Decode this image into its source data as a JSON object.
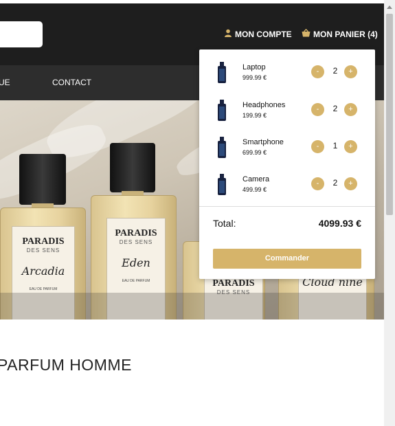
{
  "header": {
    "account_label": "MON COMPTE",
    "cart_label": "MON PANIER (4)",
    "account_icon": "user-icon",
    "cart_icon": "basket-icon"
  },
  "nav": {
    "items": [
      {
        "label": "UE"
      },
      {
        "label": "CONTACT"
      }
    ]
  },
  "hero": {
    "bottles": [
      {
        "brand": "PARADIS",
        "sub": "DES SENS",
        "script": "Arcadia",
        "small": "EAU DE PARFUM"
      },
      {
        "brand": "PARADIS",
        "sub": "DES SENS",
        "script": "Eden",
        "small": "EAU DE PARFUM"
      },
      {
        "brand": "PARADIS",
        "sub": "DES SENS",
        "script": "",
        "small": ""
      },
      {
        "brand": "",
        "sub": "",
        "script": "Cloud nine",
        "small": ""
      }
    ]
  },
  "section": {
    "title": "PARFUM HOMME"
  },
  "cart": {
    "items": [
      {
        "name": "Laptop",
        "price": "999.99 €",
        "qty": "2"
      },
      {
        "name": "Headphones",
        "price": "199.99 €",
        "qty": "2"
      },
      {
        "name": "Smartphone",
        "price": "699.99 €",
        "qty": "1"
      },
      {
        "name": "Camera",
        "price": "499.99 €",
        "qty": "2"
      }
    ],
    "minus_label": "-",
    "plus_label": "+",
    "total_label": "Total:",
    "total_value": "4099.93 €",
    "checkout_label": "Commander"
  },
  "colors": {
    "accent": "#d6b46a",
    "header_bg": "#1e1e1e",
    "nav_bg": "#2d2d2d"
  }
}
